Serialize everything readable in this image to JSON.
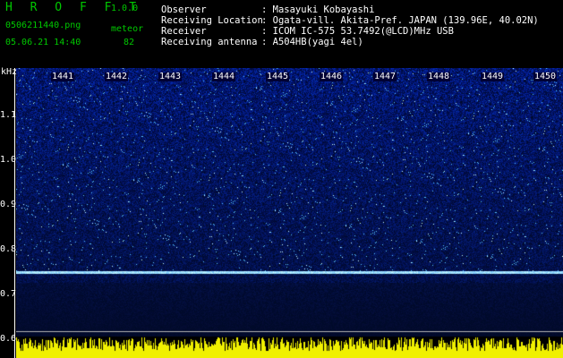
{
  "app": {
    "name": "H R O F F T",
    "version": "1.0.0"
  },
  "file": {
    "name": "0506211440.png",
    "datetime": "05.06.21 14:40"
  },
  "counter": {
    "label": "meteor",
    "value": "82"
  },
  "info": [
    {
      "key": "Observer",
      "value": ": Masayuki Kobayashi"
    },
    {
      "key": "Receiving Location",
      "value": ": Ogata-vill. Akita-Pref. JAPAN (139.96E, 40.02N)"
    },
    {
      "key": "Receiver",
      "value": ": ICOM IC-575 53.7492(@LCD)MHz USB"
    },
    {
      "key": "Receiving antenna",
      "value": ": A504HB(yagi 4el)"
    }
  ],
  "axis": {
    "unit": "kHz",
    "ticks": [
      "1.1",
      "1.0",
      "0.9",
      "0.8",
      "0.7",
      "0.6"
    ],
    "minutes": [
      "1441",
      "1442",
      "1443",
      "1444",
      "1445",
      "1446",
      "1447",
      "1448",
      "1449",
      "1450"
    ]
  },
  "colors": {
    "background": "#000000",
    "header_green": "#00c800",
    "noise_blue": "#1428c8",
    "trace": "#7ad8ff",
    "bottom_bars": "#f0f000"
  }
}
